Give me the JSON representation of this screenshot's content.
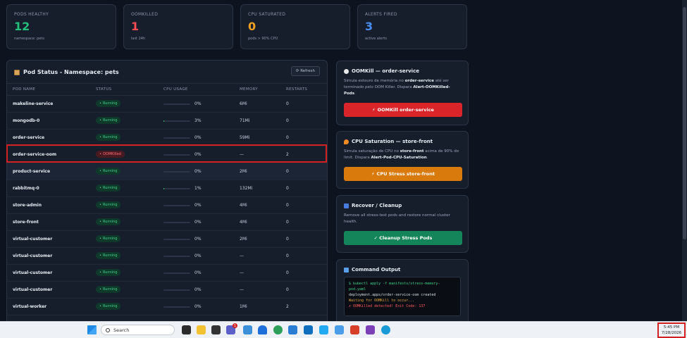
{
  "stats": [
    {
      "label": "PODS HEALTHY",
      "value": "12",
      "sub": "namespace: pets",
      "color": "#22c07a"
    },
    {
      "label": "OOMKILLED",
      "value": "1",
      "sub": "last 24h",
      "color": "#ff4d55"
    },
    {
      "label": "CPU SATURATED",
      "value": "0",
      "sub": "pods > 90% CPU",
      "color": "#f0a020"
    },
    {
      "label": "ALERTS FIRED",
      "value": "3",
      "sub": "active alerts",
      "color": "#4a8cf0"
    }
  ],
  "pod_panel": {
    "title": "Pod Status - Namespace: pets",
    "refresh_label": "⟳ Refresh",
    "columns": [
      "POD NAME",
      "STATUS",
      "CPU USAGE",
      "MEMORY",
      "RESTARTS"
    ],
    "rows": [
      {
        "name": "makeline-service",
        "status": "Running",
        "cpu": "0%",
        "cpu_frac": 0.0,
        "memory": "6Mi",
        "restarts": "0"
      },
      {
        "name": "mongodb-0",
        "status": "Running",
        "cpu": "3%",
        "cpu_frac": 0.03,
        "memory": "71Mi",
        "restarts": "0"
      },
      {
        "name": "order-service",
        "status": "Running",
        "cpu": "0%",
        "cpu_frac": 0.0,
        "memory": "59Mi",
        "restarts": "0"
      },
      {
        "name": "order-service-oom",
        "status": "OOMKilled",
        "cpu": "0%",
        "cpu_frac": 0.0,
        "memory": "—",
        "restarts": "2"
      },
      {
        "name": "product-service",
        "status": "Running",
        "cpu": "0%",
        "cpu_frac": 0.0,
        "memory": "2Mi",
        "restarts": "0"
      },
      {
        "name": "rabbitmq-0",
        "status": "Running",
        "cpu": "1%",
        "cpu_frac": 0.01,
        "memory": "132Mi",
        "restarts": "0"
      },
      {
        "name": "store-admin",
        "status": "Running",
        "cpu": "0%",
        "cpu_frac": 0.0,
        "memory": "4Mi",
        "restarts": "0"
      },
      {
        "name": "store-front",
        "status": "Running",
        "cpu": "0%",
        "cpu_frac": 0.0,
        "memory": "4Mi",
        "restarts": "0"
      },
      {
        "name": "virtual-customer",
        "status": "Running",
        "cpu": "0%",
        "cpu_frac": 0.0,
        "memory": "2Mi",
        "restarts": "0"
      },
      {
        "name": "virtual-customer",
        "status": "Running",
        "cpu": "0%",
        "cpu_frac": 0.0,
        "memory": "—",
        "restarts": "0"
      },
      {
        "name": "virtual-customer",
        "status": "Running",
        "cpu": "0%",
        "cpu_frac": 0.0,
        "memory": "—",
        "restarts": "0"
      },
      {
        "name": "virtual-customer",
        "status": "Running",
        "cpu": "0%",
        "cpu_frac": 0.0,
        "memory": "—",
        "restarts": "0"
      },
      {
        "name": "virtual-worker",
        "status": "Running",
        "cpu": "0%",
        "cpu_frac": 0.0,
        "memory": "1Mi",
        "restarts": "2"
      }
    ]
  },
  "oomkill": {
    "title": "OOMKill — order-service",
    "desc_1": "Simula estouro de memória no ",
    "desc_bold_1": "order-service",
    "desc_2": " até ser terminado pelo OOM Killer. Dispara ",
    "desc_bold_2": "Alert-OOMKilled-Pods",
    "desc_3": ".",
    "button": "OOMKill order-service",
    "button_glyph": "⚡"
  },
  "cpu_sat": {
    "title": "CPU Saturation — store-front",
    "desc_1": "Simula saturação de CPU no ",
    "desc_bold_1": "store-front",
    "desc_2": " acima de 90% do limit. Dispara ",
    "desc_bold_2": "Alert-Pod-CPU-Saturation",
    "desc_3": ".",
    "button": "CPU Stress store-front",
    "button_glyph": "⚡"
  },
  "recover": {
    "title": "Recover / Cleanup",
    "desc": "Remove all stress-test pods and restore normal cluster health.",
    "button": "✓ Cleanup Stress Pods"
  },
  "command_output": {
    "title": "Command Output",
    "cmd": "$ kubectl apply -f manifests/stress-memory-pod.yaml",
    "out": "deployment.apps/order-service-oom created",
    "warn": "Waiting for OOMKill to occur...",
    "err": "✗ OOMKilled detected! Exit Code: 137"
  },
  "taskbar": {
    "search_placeholder": "Search",
    "time": "5:45 PM",
    "date": "7/28/2026",
    "badge": "1"
  }
}
